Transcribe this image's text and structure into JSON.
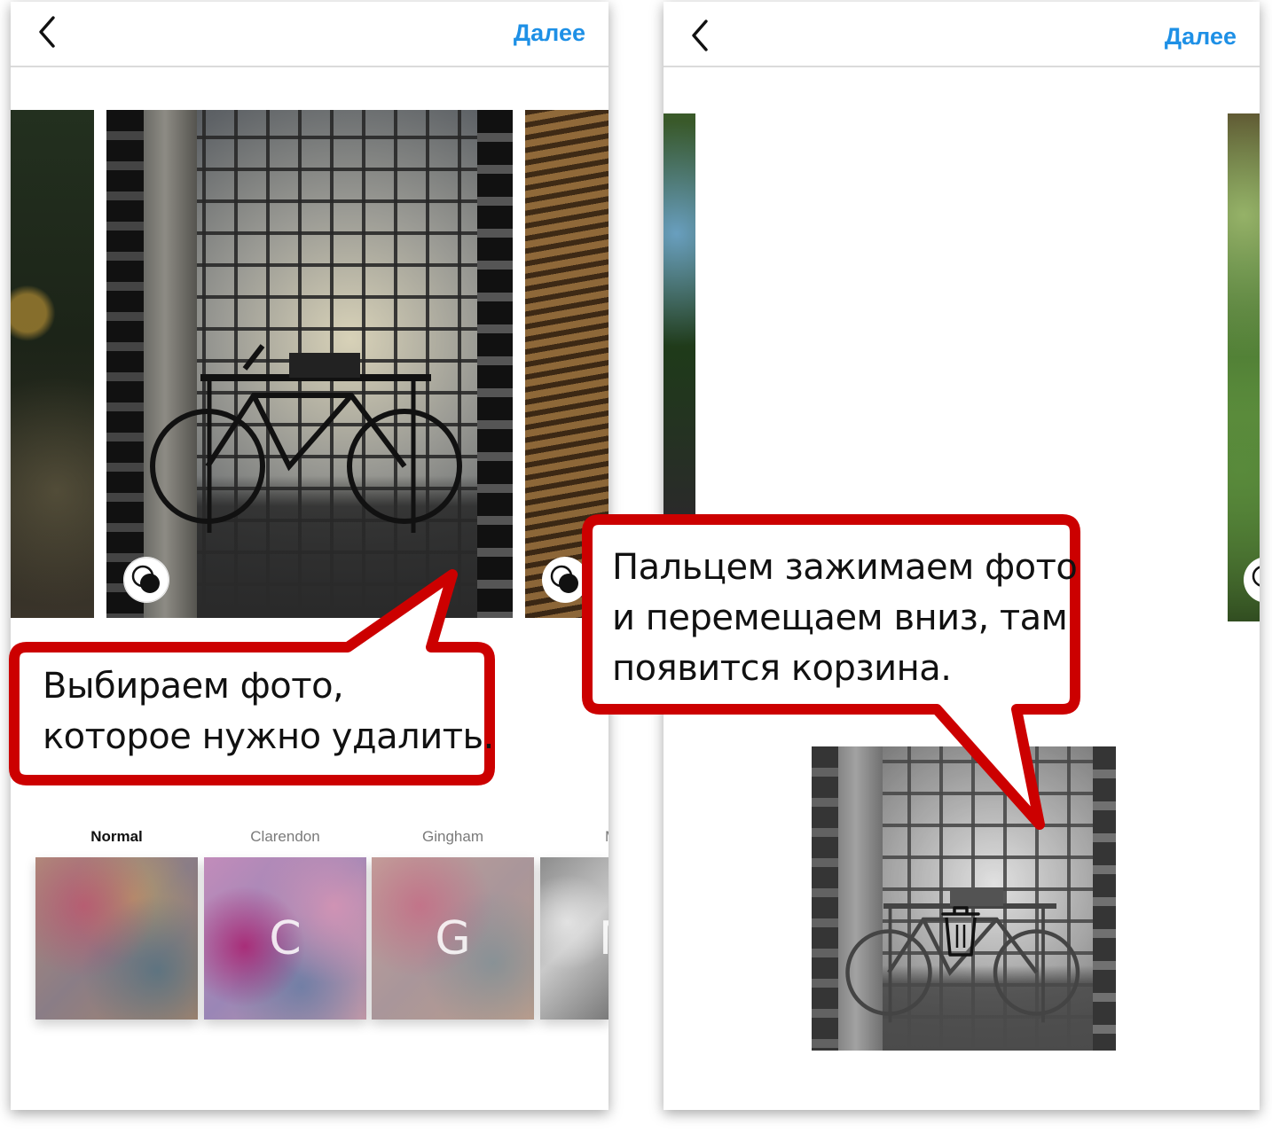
{
  "left_screen": {
    "header": {
      "back_icon": "chevron-left-icon",
      "next_label": "Далее"
    },
    "filters": [
      {
        "label": "Normal",
        "letter": "",
        "selected": true
      },
      {
        "label": "Clarendon",
        "letter": "C",
        "selected": false
      },
      {
        "label": "Gingham",
        "letter": "G",
        "selected": false
      },
      {
        "label": "M",
        "letter": "M",
        "selected": false
      }
    ],
    "callout": {
      "line1": "Выбираем фото,",
      "line2": "которое нужно удалить."
    }
  },
  "right_screen": {
    "header": {
      "back_icon": "chevron-left-icon",
      "next_label": "Далее"
    },
    "callout": {
      "line1": "Пальцем зажимаем фото",
      "line2": "и перемещаем вниз, там",
      "line3": "появится корзина."
    },
    "dragged_photo_icon": "trash-icon"
  },
  "colors": {
    "accent": "#1e90e6",
    "callout_border": "#cc0000"
  }
}
